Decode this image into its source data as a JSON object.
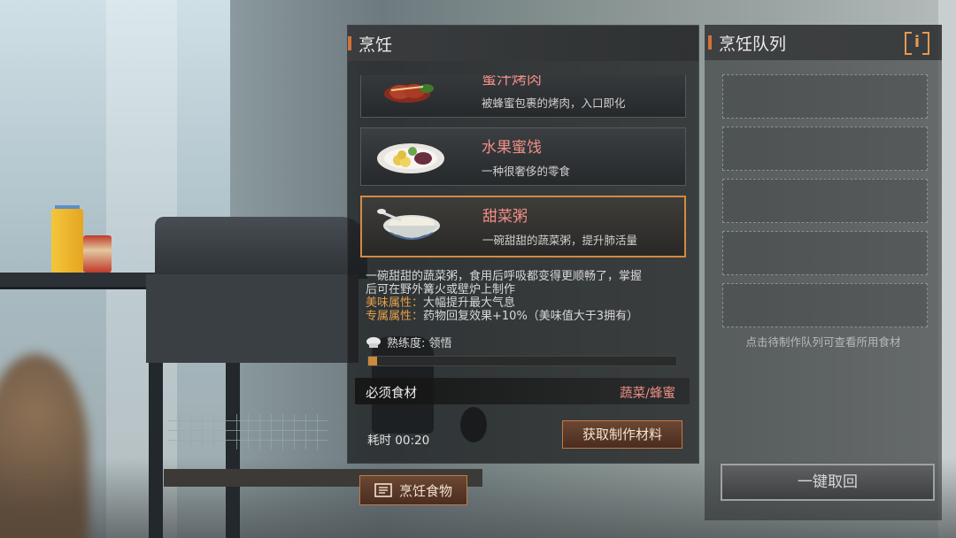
{
  "cooking_panel": {
    "title": "烹饪",
    "recipes": [
      {
        "name": "蜜汁烤肉",
        "desc": "被蜂蜜包裹的烤肉，入口即化",
        "icon": "honey-roast-meat-icon"
      },
      {
        "name": "水果蜜饯",
        "desc": "一种很奢侈的零食",
        "icon": "candied-fruit-icon"
      },
      {
        "name": "甜菜粥",
        "desc": "一碗甜甜的蔬菜粥，提升肺活量",
        "icon": "vegetable-porridge-icon"
      }
    ],
    "selected_index": 2,
    "detail": {
      "line1": "一碗甜甜的蔬菜粥，食用后呼吸都变得更顺畅了，掌握",
      "line2": "后可在野外篝火或壁炉上制作",
      "taste_label": "美味属性：",
      "taste_value": "大幅提升最大气息",
      "special_label": "专属属性：",
      "special_value": "药物回复效果+10%（美味值大于3拥有）"
    },
    "proficiency": {
      "text": "熟练度: 领悟",
      "progress": 0.03
    },
    "required": {
      "label": "必须食材",
      "value": "蔬菜/蜂蜜"
    },
    "time": "耗时 00:20",
    "get_materials_button": "获取制作材料",
    "cook_button": "烹饪食物"
  },
  "queue_panel": {
    "title": "烹饪队列",
    "info": "i",
    "slots": 5,
    "hint": "点击待制作队列可查看所用食材",
    "recall_button": "一键取回"
  },
  "colors": {
    "accent": "#d0733a",
    "recipe_name": "#f08f86",
    "attribute": "#e6a04a"
  }
}
